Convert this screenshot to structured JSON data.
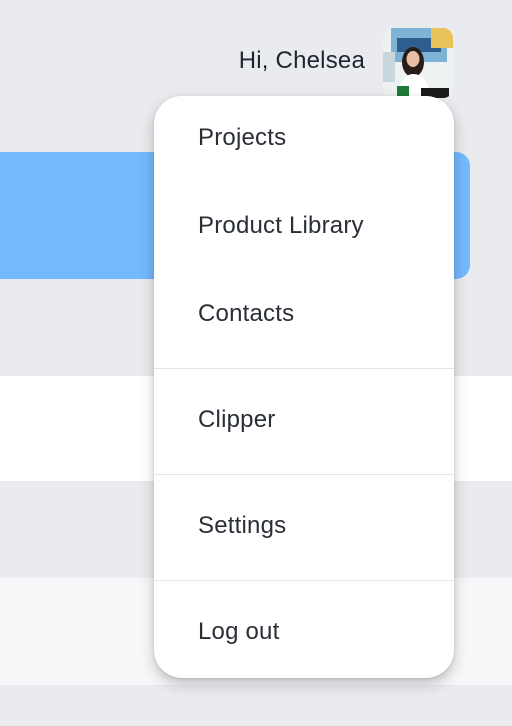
{
  "header": {
    "greeting": "Hi, Chelsea",
    "avatar_icon": "user-avatar-photo"
  },
  "menu": {
    "items": [
      {
        "label": "Projects"
      },
      {
        "label": "Product Library"
      },
      {
        "label": "Contacts"
      },
      {
        "label": "Clipper"
      },
      {
        "label": "Settings"
      },
      {
        "label": "Log out"
      }
    ]
  },
  "colors": {
    "background": "#e9ebee",
    "selected_row": "#74b9fd",
    "menu_background": "#ffffff",
    "text": "#2a2e36"
  }
}
